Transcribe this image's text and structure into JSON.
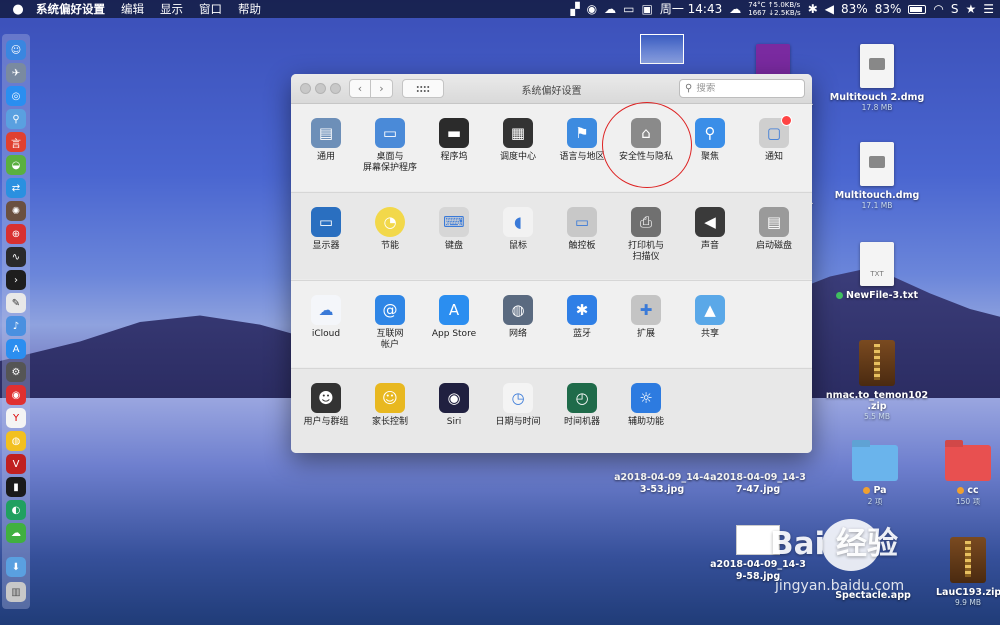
{
  "menubar": {
    "app_name": "系统偏好设置",
    "menus": [
      "编辑",
      "显示",
      "窗口",
      "帮助"
    ],
    "temperature": "74°C",
    "fan": "1667",
    "upload": "↑5.0KB/s",
    "download": "↓2.5KB/s",
    "datetime": "周一 14:43",
    "battery_left": "83%",
    "battery_right": "83%"
  },
  "window": {
    "title": "系统偏好设置",
    "search_placeholder": "搜索",
    "sections": [
      [
        {
          "label": "通用",
          "icon": "general-icon",
          "color": "#6d8fb8"
        },
        {
          "label": "桌面与\n屏幕保护程序",
          "icon": "desktop-screensaver-icon",
          "color": "#4a8ad8"
        },
        {
          "label": "程序坞",
          "icon": "dock-icon",
          "color": "#2b2b2b"
        },
        {
          "label": "调度中心",
          "icon": "mission-control-icon",
          "color": "#333333"
        },
        {
          "label": "语言与地区",
          "icon": "language-region-icon",
          "color": "#3d8be0"
        },
        {
          "label": "安全性与隐私",
          "icon": "security-privacy-icon",
          "color": "#8a8a8a"
        },
        {
          "label": "聚焦",
          "icon": "spotlight-icon",
          "color": "#3a8ee8"
        },
        {
          "label": "通知",
          "icon": "notifications-icon",
          "color": "#cfcfcf"
        }
      ],
      [
        {
          "label": "显示器",
          "icon": "displays-icon",
          "color": "#2a6fc0"
        },
        {
          "label": "节能",
          "icon": "energy-saver-icon",
          "color": "#f2d84a"
        },
        {
          "label": "键盘",
          "icon": "keyboard-icon",
          "color": "#d6d6d6"
        },
        {
          "label": "鼠标",
          "icon": "mouse-icon",
          "color": "#f2f2f2"
        },
        {
          "label": "触控板",
          "icon": "trackpad-icon",
          "color": "#c8c8c8"
        },
        {
          "label": "打印机与\n扫描仪",
          "icon": "printer-scanner-icon",
          "color": "#707070"
        },
        {
          "label": "声音",
          "icon": "sound-icon",
          "color": "#3a3a3a"
        },
        {
          "label": "启动磁盘",
          "icon": "startup-disk-icon",
          "color": "#9a9a9a"
        }
      ],
      [
        {
          "label": "iCloud",
          "icon": "icloud-icon",
          "color": "#f4f6fa"
        },
        {
          "label": "互联网\n帐户",
          "icon": "internet-accounts-icon",
          "color": "#2f86e6"
        },
        {
          "label": "App Store",
          "icon": "app-store-icon",
          "color": "#2b8ef0"
        },
        {
          "label": "网络",
          "icon": "network-icon",
          "color": "#5a6a80"
        },
        {
          "label": "蓝牙",
          "icon": "bluetooth-icon",
          "color": "#2f7fe6"
        },
        {
          "label": "扩展",
          "icon": "extensions-icon",
          "color": "#c4c4c4"
        },
        {
          "label": "共享",
          "icon": "sharing-icon",
          "color": "#5aa8e8"
        }
      ],
      [
        {
          "label": "用户与群组",
          "icon": "users-groups-icon",
          "color": "#333333"
        },
        {
          "label": "家长控制",
          "icon": "parental-controls-icon",
          "color": "#e8b820"
        },
        {
          "label": "Siri",
          "icon": "siri-icon",
          "color": "#202040"
        },
        {
          "label": "日期与时间",
          "icon": "date-time-icon",
          "color": "#f4f4f4"
        },
        {
          "label": "时间机器",
          "icon": "time-machine-icon",
          "color": "#1f6b4a"
        },
        {
          "label": "辅助功能",
          "icon": "accessibility-icon",
          "color": "#2d7be0"
        }
      ]
    ]
  },
  "desktop": {
    "files": [
      {
        "label": "Multitouch 2.dmg",
        "sub": "17.8 MB"
      },
      {
        "label": "Multitouch.dmg",
        "sub": "17.1 MB"
      },
      {
        "label": "NewFile-3.txt",
        "sub": ""
      },
      {
        "label": "nmac.to_temon102\n.zip",
        "sub": "5.5 MB"
      },
      {
        "label": "Pa",
        "sub": "2 项"
      },
      {
        "label": "cc",
        "sub": "150 项"
      },
      {
        "label": "LauC193.zip",
        "sub": "9.9 MB"
      },
      {
        "label": "a2018-04-09_14-4\n3-53.jpg",
        "sub": ""
      },
      {
        "label": "a2018-04-09_14-3\n7-47.jpg",
        "sub": ""
      },
      {
        "label": "a2018-04-09_14-3\n9-58.jpg",
        "sub": ""
      },
      {
        "label": "Spectacle.app",
        "sub": ""
      }
    ],
    "file_icon_text": "TXT",
    "partial_labels": [
      "K.",
      "K."
    ]
  },
  "watermark": {
    "brand": "Bai  经验",
    "url": "jingyan.baidu.com"
  },
  "colors": {
    "annotation_circle": "#d22222",
    "pa_dot": "#f0a030",
    "cc_dot": "#f0a030",
    "newfile_dot": "#40c060"
  }
}
